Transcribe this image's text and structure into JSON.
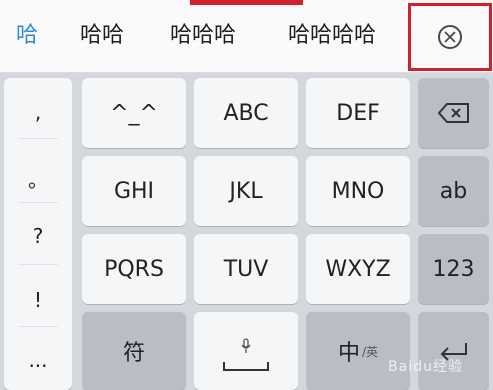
{
  "candidates": {
    "items": [
      "哈",
      "哈哈",
      "哈哈哈",
      "哈哈哈哈"
    ]
  },
  "punctuation": [
    ",",
    "。",
    "?",
    "!",
    "..."
  ],
  "keys": {
    "emoticon": "^_^",
    "abc": "ABC",
    "def": "DEF",
    "ghi": "GHI",
    "jkl": "JKL",
    "mno": "MNO",
    "ab": "ab",
    "pqrs": "PQRS",
    "tuv": "TUV",
    "wxyz": "WXYZ",
    "num": "123",
    "symbol": "符",
    "lang": "中",
    "lang_small": "/英"
  },
  "watermark": "Baidu经验",
  "colors": {
    "accent": "#2f8bd6",
    "highlight_border": "#d3202e"
  },
  "icons": {
    "close": "close-circle-icon",
    "backspace": "backspace-icon",
    "mic": "microphone-icon",
    "space": "space-bar-icon",
    "enter": "enter-icon"
  }
}
